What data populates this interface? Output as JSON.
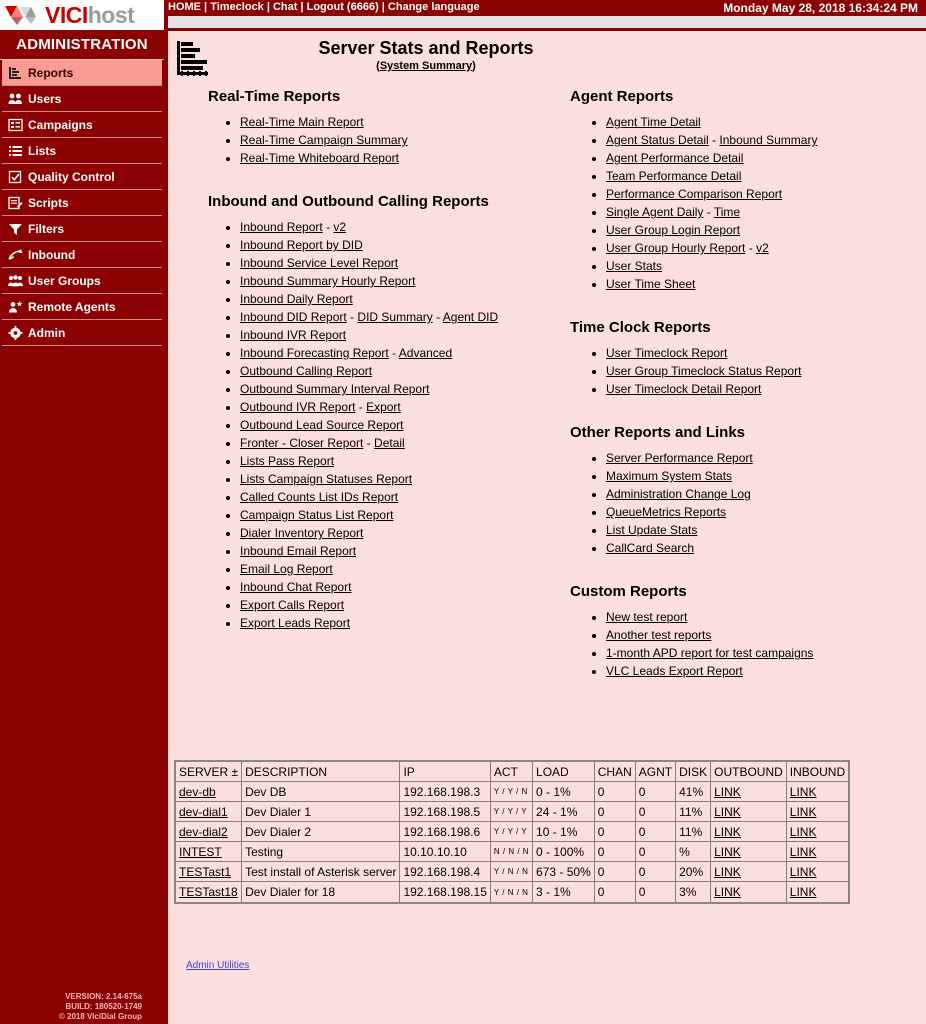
{
  "brand": {
    "logo_vici": "VICI",
    "logo_host": "host",
    "colors": {
      "primary": "#8b0000",
      "content_bg": "#fbdfdc",
      "active_item": "#f89b90",
      "accent": "#cc0000"
    }
  },
  "topnav": {
    "text": "HOME | Timeclock | Chat | Logout (6666) | Change language",
    "datetime": "Monday May 28, 2018 16:34:24 PM"
  },
  "sidebar": {
    "title": "ADMINISTRATION",
    "items": [
      {
        "label": "Reports",
        "icon": "bar-chart-icon",
        "active": true
      },
      {
        "label": "Users",
        "icon": "users-icon",
        "active": false
      },
      {
        "label": "Campaigns",
        "icon": "campaigns-icon",
        "active": false
      },
      {
        "label": "Lists",
        "icon": "lists-icon",
        "active": false
      },
      {
        "label": "Quality Control",
        "icon": "checkbox-icon",
        "active": false
      },
      {
        "label": "Scripts",
        "icon": "script-icon",
        "active": false
      },
      {
        "label": "Filters",
        "icon": "funnel-icon",
        "active": false
      },
      {
        "label": "Inbound",
        "icon": "inbound-arrow-icon",
        "active": false
      },
      {
        "label": "User Groups",
        "icon": "user-groups-icon",
        "active": false
      },
      {
        "label": "Remote Agents",
        "icon": "remote-agent-icon",
        "active": false
      },
      {
        "label": "Admin",
        "icon": "gear-icon",
        "active": false
      }
    ],
    "version": "VERSION: 2.14-675a",
    "build": "BUILD: 180520-1749",
    "copyright": "© 2018 ViciDial Group"
  },
  "page": {
    "title": "Server Stats and Reports",
    "subtitle": "(System Summary)",
    "icon": "bar-chart-icon"
  },
  "sections": {
    "realtime": {
      "heading": "Real-Time Reports",
      "items": [
        {
          "parts": [
            {
              "text": "Real-Time Main Report",
              "link": true
            }
          ]
        },
        {
          "parts": [
            {
              "text": "Real-Time Campaign Summary",
              "link": true
            }
          ]
        },
        {
          "parts": [
            {
              "text": "Real-Time Whiteboard Report",
              "link": true
            }
          ]
        }
      ]
    },
    "calling": {
      "heading": "Inbound and Outbound Calling Reports",
      "items": [
        {
          "parts": [
            {
              "text": "Inbound Report",
              "link": true
            },
            {
              "text": " - ",
              "link": false
            },
            {
              "text": "v2",
              "link": true
            }
          ]
        },
        {
          "parts": [
            {
              "text": "Inbound Report by DID",
              "link": true
            }
          ]
        },
        {
          "parts": [
            {
              "text": "Inbound Service Level Report",
              "link": true
            }
          ]
        },
        {
          "parts": [
            {
              "text": "Inbound Summary Hourly Report",
              "link": true
            }
          ]
        },
        {
          "parts": [
            {
              "text": "Inbound Daily Report",
              "link": true
            }
          ]
        },
        {
          "parts": [
            {
              "text": "Inbound DID Report",
              "link": true
            },
            {
              "text": " - ",
              "link": false
            },
            {
              "text": "DID Summary",
              "link": true
            },
            {
              "text": " - ",
              "link": false
            },
            {
              "text": "Agent DID",
              "link": true
            }
          ]
        },
        {
          "parts": [
            {
              "text": "Inbound IVR Report",
              "link": true
            }
          ]
        },
        {
          "parts": [
            {
              "text": "Inbound Forecasting Report",
              "link": true
            },
            {
              "text": " - ",
              "link": false
            },
            {
              "text": "Advanced",
              "link": true
            }
          ]
        },
        {
          "parts": [
            {
              "text": "Outbound Calling Report",
              "link": true
            }
          ]
        },
        {
          "parts": [
            {
              "text": "Outbound Summary Interval Report",
              "link": true
            }
          ]
        },
        {
          "parts": [
            {
              "text": "Outbound IVR Report",
              "link": true
            },
            {
              "text": " - ",
              "link": false
            },
            {
              "text": "Export",
              "link": true
            }
          ]
        },
        {
          "parts": [
            {
              "text": "Outbound Lead Source Report",
              "link": true
            }
          ]
        },
        {
          "parts": [
            {
              "text": "Fronter - Closer Report",
              "link": true
            },
            {
              "text": " - ",
              "link": false
            },
            {
              "text": "Detail",
              "link": true
            }
          ]
        },
        {
          "parts": [
            {
              "text": "Lists Pass Report",
              "link": true
            }
          ]
        },
        {
          "parts": [
            {
              "text": "Lists Campaign Statuses Report",
              "link": true
            }
          ]
        },
        {
          "parts": [
            {
              "text": "Called Counts List IDs Report",
              "link": true
            }
          ]
        },
        {
          "parts": [
            {
              "text": "Campaign Status List Report",
              "link": true
            }
          ]
        },
        {
          "parts": [
            {
              "text": "Dialer Inventory Report",
              "link": true
            }
          ]
        },
        {
          "parts": [
            {
              "text": "Inbound Email Report",
              "link": true
            }
          ]
        },
        {
          "parts": [
            {
              "text": "Email Log Report",
              "link": true
            }
          ]
        },
        {
          "parts": [
            {
              "text": "Inbound Chat Report",
              "link": true
            }
          ]
        },
        {
          "parts": [
            {
              "text": "Export Calls Report",
              "link": true
            }
          ]
        },
        {
          "parts": [
            {
              "text": "Export Leads Report",
              "link": true
            }
          ]
        }
      ]
    },
    "agent": {
      "heading": "Agent Reports",
      "items": [
        {
          "parts": [
            {
              "text": "Agent Time Detail",
              "link": true
            }
          ]
        },
        {
          "parts": [
            {
              "text": "Agent Status Detail",
              "link": true
            },
            {
              "text": " - ",
              "link": false
            },
            {
              "text": "Inbound Summary",
              "link": true
            }
          ]
        },
        {
          "parts": [
            {
              "text": "Agent Performance Detail",
              "link": true
            }
          ]
        },
        {
          "parts": [
            {
              "text": "Team Performance Detail",
              "link": true
            }
          ]
        },
        {
          "parts": [
            {
              "text": "Performance Comparison Report",
              "link": true
            }
          ]
        },
        {
          "parts": [
            {
              "text": "Single Agent Daily",
              "link": true
            },
            {
              "text": " - ",
              "link": false
            },
            {
              "text": "Time",
              "link": true
            }
          ]
        },
        {
          "parts": [
            {
              "text": "User Group Login Report",
              "link": true
            }
          ]
        },
        {
          "parts": [
            {
              "text": "User Group Hourly Report",
              "link": true
            },
            {
              "text": " - ",
              "link": false
            },
            {
              "text": "v2",
              "link": true
            }
          ]
        },
        {
          "parts": [
            {
              "text": "User Stats",
              "link": true
            }
          ]
        },
        {
          "parts": [
            {
              "text": "User Time Sheet",
              "link": true
            }
          ]
        }
      ]
    },
    "timeclock": {
      "heading": "Time Clock Reports",
      "items": [
        {
          "parts": [
            {
              "text": "User Timeclock Report",
              "link": true
            }
          ]
        },
        {
          "parts": [
            {
              "text": "User Group Timeclock Status Report",
              "link": true
            }
          ]
        },
        {
          "parts": [
            {
              "text": "User Timeclock Detail Report",
              "link": true
            }
          ]
        }
      ]
    },
    "other": {
      "heading": "Other Reports and Links",
      "items": [
        {
          "parts": [
            {
              "text": "Server Performance Report",
              "link": true
            }
          ]
        },
        {
          "parts": [
            {
              "text": "Maximum System Stats",
              "link": true
            }
          ]
        },
        {
          "parts": [
            {
              "text": "Administration Change Log",
              "link": true
            }
          ]
        },
        {
          "parts": [
            {
              "text": "QueueMetrics Reports",
              "link": true
            }
          ]
        },
        {
          "parts": [
            {
              "text": "List Update Stats",
              "link": true
            }
          ]
        },
        {
          "parts": [
            {
              "text": "CallCard Search",
              "link": true
            }
          ]
        }
      ]
    },
    "custom": {
      "heading": "Custom Reports",
      "items": [
        {
          "parts": [
            {
              "text": "New test report",
              "link": true
            }
          ]
        },
        {
          "parts": [
            {
              "text": "Another test reports",
              "link": true
            }
          ]
        },
        {
          "parts": [
            {
              "text": "1-month APD report for test campaigns",
              "link": true
            }
          ]
        },
        {
          "parts": [
            {
              "text": "VLC Leads Export Report",
              "link": true
            }
          ]
        }
      ]
    }
  },
  "server_table": {
    "columns": [
      "SERVER ±",
      "DESCRIPTION",
      "IP",
      "ACT",
      "LOAD",
      "CHAN",
      "AGNT",
      "DISK",
      "OUTBOUND",
      "INBOUND"
    ],
    "rows": [
      {
        "server": "dev-db",
        "description": "Dev DB",
        "ip": "192.168.198.3",
        "act": "Y / Y / N",
        "load": "0 - 1%",
        "chan": "0",
        "agnt": "0",
        "disk": "41%",
        "outbound": "LINK",
        "inbound": "LINK"
      },
      {
        "server": "dev-dial1",
        "description": "Dev Dialer 1",
        "ip": "192.168.198.5",
        "act": "Y / Y / Y",
        "load": "24 - 1%",
        "chan": "0",
        "agnt": "0",
        "disk": "11%",
        "outbound": "LINK",
        "inbound": "LINK"
      },
      {
        "server": "dev-dial2",
        "description": "Dev Dialer 2",
        "ip": "192.168.198.6",
        "act": "Y / Y / Y",
        "load": "10 - 1%",
        "chan": "0",
        "agnt": "0",
        "disk": "11%",
        "outbound": "LINK",
        "inbound": "LINK"
      },
      {
        "server": "INTEST",
        "description": "Testing",
        "ip": "10.10.10.10",
        "act": "N / N / N",
        "load": "0 - 100%",
        "chan": "0",
        "agnt": "0",
        "disk": "%",
        "outbound": "LINK",
        "inbound": "LINK"
      },
      {
        "server": "TESTast1",
        "description": "Test install of Asterisk server",
        "ip": "192.168.198.4",
        "act": "Y / N / N",
        "load": "673 - 50%",
        "chan": "0",
        "agnt": "0",
        "disk": "20%",
        "outbound": "LINK",
        "inbound": "LINK"
      },
      {
        "server": "TESTast18",
        "description": "Dev Dialer for 18",
        "ip": "192.168.198.15",
        "act": "Y / N / N",
        "load": "3 - 1%",
        "chan": "0",
        "agnt": "0",
        "disk": "3%",
        "outbound": "LINK",
        "inbound": "LINK"
      }
    ]
  },
  "footer": {
    "admin_utilities": "Admin Utilities"
  }
}
